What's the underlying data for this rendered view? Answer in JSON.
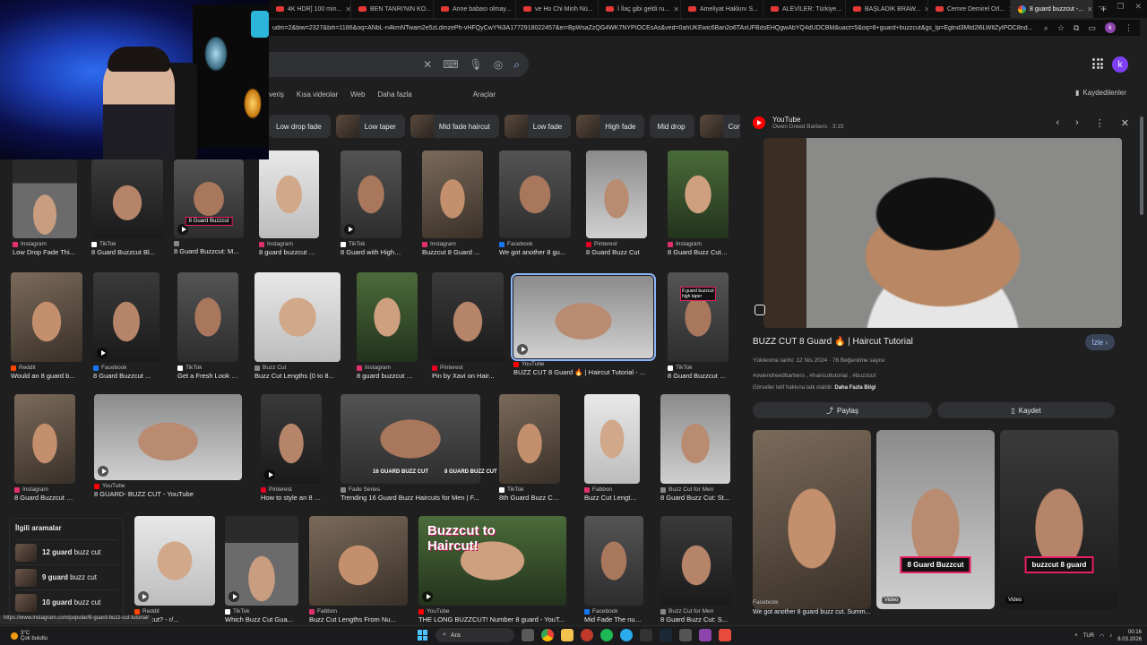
{
  "browser": {
    "tabs": [
      {
        "label": "4K HDR] 100 min...",
        "icon": "youtube-icon",
        "active": false
      },
      {
        "label": "BEN TANRI'NIN KO...",
        "icon": "youtube-icon",
        "active": false
      },
      {
        "label": "Anne babası olmay...",
        "icon": "youtube-icon",
        "active": false
      },
      {
        "label": "ve Ho Chi Minh Nü...",
        "icon": "youtube-icon",
        "active": false
      },
      {
        "label": "İ İlaç gibi geldi ru...",
        "icon": "youtube-icon",
        "active": false
      },
      {
        "label": "Ameliyat Hakkını S...",
        "icon": "youtube-icon",
        "active": false
      },
      {
        "label": "ALEVİLER: Türkiye...",
        "icon": "youtube-icon",
        "active": false
      },
      {
        "label": "BAŞLADIK BRAW...",
        "icon": "youtube-icon",
        "active": false
      },
      {
        "label": "Cemre Demirel Orl...",
        "icon": "youtube-icon",
        "active": false
      },
      {
        "label": "8 guard buzzcut -...",
        "icon": "google-icon",
        "active": true
      }
    ],
    "url": "udm=2&biw=2327&bih=1186&oq=ANbL-n4kmNTwam2e5zLdmzePh-vHFQyCwY%3A1772918022457&ei=BpWsaZzQG4WK7NYPIOCEsAs&ved=0ahUKEwic6Ban2o6TAxUFBdsEHQgwAbYQ4dUDCBM&uact=5&oq=8+guard+buzzcut&gs_lp=Egtnd3Mtd2l6LWltZyIPOC8nd...",
    "account_initial": "k"
  },
  "search": {
    "filters": [
      "veriş",
      "Kısa videolar",
      "Web",
      "Daha fazla"
    ],
    "tools_label": "Araçlar",
    "saved_label": "Kaydedilenler",
    "chips": [
      {
        "label": "Low drop fade",
        "thumb": false
      },
      {
        "label": "Low taper",
        "thumb": true
      },
      {
        "label": "Mid fade haircut",
        "thumb": true
      },
      {
        "label": "Low fade",
        "thumb": true
      },
      {
        "label": "High fade",
        "thumb": true
      },
      {
        "label": "Mid drop",
        "thumb": false
      },
      {
        "label": "Con la",
        "thumb": true
      }
    ]
  },
  "results": [
    {
      "src": "Instagram",
      "title": "Low Drop Fade Thi...",
      "fav": "#e1306c"
    },
    {
      "src": "TikTok",
      "title": "8 Guard Buzzcut Bl...",
      "fav": "#ffffff"
    },
    {
      "src": "",
      "title": "8 Guard Buzzcut: M...",
      "fav": "#888888",
      "badge": "8 Guard Buzzcut"
    },
    {
      "src": "Instagram",
      "title": "8 guard buzzcut 😘 ...",
      "fav": "#e1306c"
    },
    {
      "src": "TikTok",
      "title": "8 Guard with High T...",
      "fav": "#ffffff"
    },
    {
      "src": "Instagram",
      "title": "Buzzcut 8 Guard ...",
      "fav": "#e1306c"
    },
    {
      "src": "Facebook",
      "title": "We got another 8 gu...",
      "fav": "#1877f2"
    },
    {
      "src": "Pinterest",
      "title": "8 Guard Buzz Cut",
      "fav": "#e60023"
    },
    {
      "src": "Instagram",
      "title": "8 Guard Buzz Cut T...",
      "fav": "#e1306c"
    },
    {
      "src": "Reddit",
      "title": "Would an 8 guard b...",
      "fav": "#ff4500"
    },
    {
      "src": "Facebook",
      "title": "8 Guard Buzzcut ...",
      "fav": "#1877f2"
    },
    {
      "src": "TikTok",
      "title": "Get a Fresh Look wi...",
      "fav": "#ffffff"
    },
    {
      "src": "Buzz Cut",
      "title": "Buzz Cut Lengths (0 to 8...",
      "fav": "#888888"
    },
    {
      "src": "Instagram",
      "title": "8 guard buzzcut 🕸 ...",
      "fav": "#e1306c"
    },
    {
      "src": "Pinterest",
      "title": "Pin by Xavi on Hair...",
      "fav": "#e60023"
    },
    {
      "src": "YouTube",
      "title": "BUZZ CUT 8 Guard 🔥 | Haircut Tutorial - ...",
      "fav": "#ff0000",
      "selected": true
    },
    {
      "src": "TikTok",
      "title": "8 Guard Buzzcut wi...",
      "fav": "#ffffff"
    },
    {
      "src": "Instagram",
      "title": "8 Guard Buzzcut W...",
      "fav": "#e1306c"
    },
    {
      "src": "YouTube",
      "title": "8 GUARD- BUZZ CUT - YouTube",
      "fav": "#ff0000"
    },
    {
      "src": "Pinterest",
      "title": "How to style an 8 gu...",
      "fav": "#e60023"
    },
    {
      "src": "Fade Series",
      "title": "Trending 16 Guard Buzz Haircuts for Men | F...",
      "fav": "#888888"
    },
    {
      "src": "TikTok",
      "title": "8th Guard Buzz Cut...",
      "fav": "#ffffff"
    },
    {
      "src": "Fabbon",
      "title": "Buzz Cut Lengths F...",
      "fav": "#e1306c"
    },
    {
      "src": "Buzz Cut for Men",
      "title": "8 Guard Buzz Cut: St...",
      "fav": "#888888"
    },
    {
      "src": "Reddit",
      "title": "buzz cut? - r/...",
      "fav": "#ff4500"
    },
    {
      "src": "TikTok",
      "title": "Which Buzz Cut Gua...",
      "fav": "#ffffff"
    },
    {
      "src": "Fabbon",
      "title": "Buzz Cut Lengths From Nu...",
      "fav": "#e1306c"
    },
    {
      "src": "YouTube",
      "title": "THE LONG BUZZCUT! Number 8 guard - YouT...",
      "fav": "#ff0000"
    },
    {
      "src": "Facebook",
      "title": "Mid Fade The numb...",
      "fav": "#1877f2"
    },
    {
      "src": "Buzz Cut for Men",
      "title": "8 Guard Buzz Cut: S...",
      "fav": "#888888"
    }
  ],
  "overlay_texts": {
    "buzzcut_to_haircut": "Buzzcut to Haircut!",
    "guard16": "16 GUARD BUZZ CUT",
    "guard8": "8 GUARD BUZZ CUT",
    "tiktok_badge": "8 guard buzzcut high taper"
  },
  "related": {
    "heading": "İlgili aramalar",
    "items": [
      {
        "bold": "12 guard",
        "rest": " buzz cut"
      },
      {
        "bold": "9 guard",
        "rest": " buzz cut"
      },
      {
        "bold": "10 guard",
        "rest": " buzz cut"
      }
    ]
  },
  "panel": {
    "source": "YouTube",
    "channel_meta": "Owen Dreed Barbers · 3:15",
    "title": "BUZZ CUT 8 Guard 🔥 | Haircut Tutorial",
    "visit_label": "İzle",
    "meta": "Yüklenme tarihi: 12 Nis 2024 · 76 Beğenilme sayısı",
    "tags": "#owendreedbarbers , #haircuttutorial , #buzzcut",
    "note": "Görseller telif hakkına tabi olabilir.",
    "note_link": "Daha Fazla Bilgi",
    "share_label": "Paylaş",
    "save_label": "Kaydet",
    "thumbs": [
      {
        "label": "",
        "video": ""
      },
      {
        "label": "8 Guard Buzzcut",
        "video": "Video"
      },
      {
        "label": "buzzcut 8 guard",
        "video": "Video"
      }
    ],
    "footer_source": "Facebook",
    "footer_title": "We got another 8 guard buzz cut. Summ..."
  },
  "status_link": "https://www.instagram.com/popular/8-guard-buzz-cut-tutorial/",
  "taskbar": {
    "weather_temp": "3°C",
    "weather_desc": "Çok bulutlu",
    "search_label": "Ara",
    "lang": "TUR",
    "time": "00:16",
    "date": "8.03.2026"
  }
}
